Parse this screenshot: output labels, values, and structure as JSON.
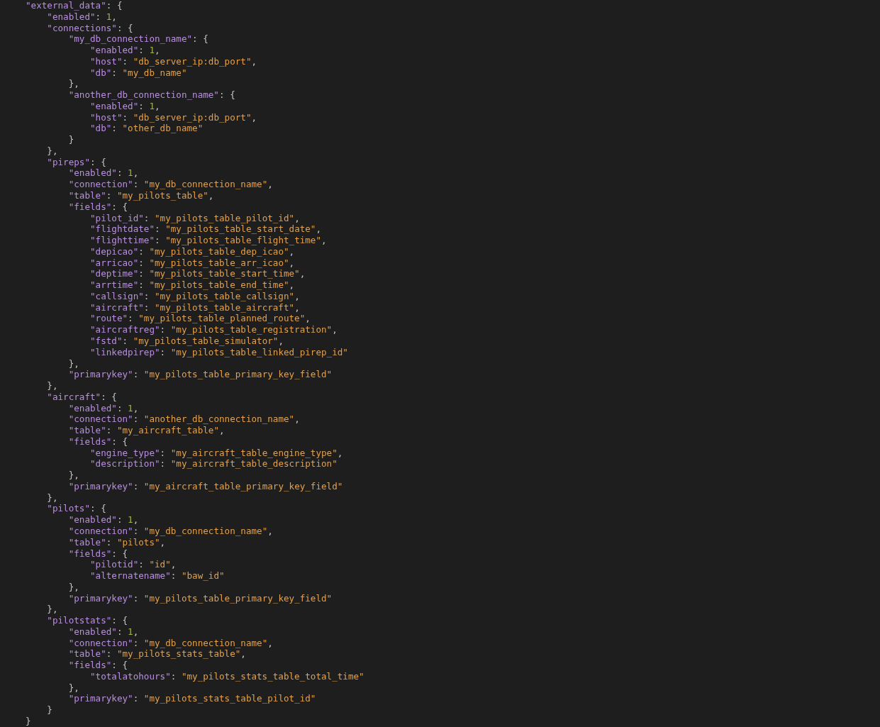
{
  "code": [
    {
      "key": "\"external_data\"",
      "colon": ":",
      "open": "{",
      "close": "}",
      "children": [
        {
          "key": "\"enabled\"",
          "colon": ":",
          "value": "1",
          "kind": "number",
          "end": ","
        },
        {
          "key": "\"connections\"",
          "colon": ":",
          "open": "{",
          "close": "},",
          "children": [
            {
              "key": "\"my_db_connection_name\"",
              "colon": ":",
              "open": "{",
              "close": "},",
              "children": [
                {
                  "key": "\"enabled\"",
                  "colon": ":",
                  "value": "1",
                  "kind": "number",
                  "end": ","
                },
                {
                  "key": "\"host\"",
                  "colon": ":",
                  "value": "\"db_server_ip:db_port\"",
                  "kind": "string",
                  "end": ","
                },
                {
                  "key": "\"db\"",
                  "colon": ":",
                  "value": "\"my_db_name\"",
                  "kind": "string"
                }
              ]
            },
            {
              "key": "\"another_db_connection_name\"",
              "colon": ":",
              "open": "{",
              "close": "}",
              "children": [
                {
                  "key": "\"enabled\"",
                  "colon": ":",
                  "value": "1",
                  "kind": "number",
                  "end": ","
                },
                {
                  "key": "\"host\"",
                  "colon": ":",
                  "value": "\"db_server_ip:db_port\"",
                  "kind": "string",
                  "end": ","
                },
                {
                  "key": "\"db\"",
                  "colon": ":",
                  "value": "\"other_db_name\"",
                  "kind": "string"
                }
              ]
            }
          ]
        },
        {
          "key": "\"pireps\"",
          "colon": ":",
          "open": "{",
          "close": "},",
          "children": [
            {
              "key": "\"enabled\"",
              "colon": ":",
              "value": "1",
              "kind": "number",
              "end": ","
            },
            {
              "key": "\"connection\"",
              "colon": ":",
              "value": "\"my_db_connection_name\"",
              "kind": "string",
              "end": ","
            },
            {
              "key": "\"table\"",
              "colon": ":",
              "value": "\"my_pilots_table\"",
              "kind": "string",
              "end": ","
            },
            {
              "key": "\"fields\"",
              "colon": ":",
              "open": "{",
              "close": "},",
              "children": [
                {
                  "key": "\"pilot_id\"",
                  "colon": ":",
                  "value": "\"my_pilots_table_pilot_id\"",
                  "kind": "string",
                  "end": ","
                },
                {
                  "key": "\"flightdate\"",
                  "colon": ":",
                  "value": "\"my_pilots_table_start_date\"",
                  "kind": "string",
                  "end": ","
                },
                {
                  "key": "\"flighttime\"",
                  "colon": ":",
                  "value": "\"my_pilots_table_flight_time\"",
                  "kind": "string",
                  "end": ","
                },
                {
                  "key": "\"depicao\"",
                  "colon": ":",
                  "value": "\"my_pilots_table_dep_icao\"",
                  "kind": "string",
                  "end": ","
                },
                {
                  "key": "\"arricao\"",
                  "colon": ":",
                  "value": "\"my_pilots_table_arr_icao\"",
                  "kind": "string",
                  "end": ","
                },
                {
                  "key": "\"deptime\"",
                  "colon": ":",
                  "value": "\"my_pilots_table_start_time\"",
                  "kind": "string",
                  "end": ","
                },
                {
                  "key": "\"arrtime\"",
                  "colon": ":",
                  "value": "\"my_pilots_table_end_time\"",
                  "kind": "string",
                  "end": ","
                },
                {
                  "key": "\"callsign\"",
                  "colon": ":",
                  "value": "\"my_pilots_table_callsign\"",
                  "kind": "string",
                  "end": ","
                },
                {
                  "key": "\"aircraft\"",
                  "colon": ":",
                  "value": "\"my_pilots_table_aircraft\"",
                  "kind": "string",
                  "end": ","
                },
                {
                  "key": "\"route\"",
                  "colon": ":",
                  "value": "\"my_pilots_table_planned_route\"",
                  "kind": "string",
                  "end": ","
                },
                {
                  "key": "\"aircraftreg\"",
                  "colon": ":",
                  "value": "\"my_pilots_table_registration\"",
                  "kind": "string",
                  "end": ","
                },
                {
                  "key": "\"fstd\"",
                  "colon": ":",
                  "value": "\"my_pilots_table_simulator\"",
                  "kind": "string",
                  "end": ","
                },
                {
                  "key": "\"linkedpirep\"",
                  "colon": ":",
                  "value": "\"my_pilots_table_linked_pirep_id\"",
                  "kind": "string"
                }
              ]
            },
            {
              "key": "\"primarykey\"",
              "colon": ":",
              "value": "\"my_pilots_table_primary_key_field\"",
              "kind": "string"
            }
          ]
        },
        {
          "key": "\"aircraft\"",
          "colon": ":",
          "open": "{",
          "close": "},",
          "children": [
            {
              "key": "\"enabled\"",
              "colon": ":",
              "value": "1",
              "kind": "number",
              "end": ","
            },
            {
              "key": "\"connection\"",
              "colon": ":",
              "value": "\"another_db_connection_name\"",
              "kind": "string",
              "end": ","
            },
            {
              "key": "\"table\"",
              "colon": ":",
              "value": "\"my_aircraft_table\"",
              "kind": "string",
              "end": ","
            },
            {
              "key": "\"fields\"",
              "colon": ":",
              "open": "{",
              "close": "},",
              "children": [
                {
                  "key": "\"engine_type\"",
                  "colon": ":",
                  "value": "\"my_aircraft_table_engine_type\"",
                  "kind": "string",
                  "end": ","
                },
                {
                  "key": "\"description\"",
                  "colon": ":",
                  "value": "\"my_aircraft_table_description\"",
                  "kind": "string"
                }
              ]
            },
            {
              "key": "\"primarykey\"",
              "colon": ":",
              "value": "\"my_aircraft_table_primary_key_field\"",
              "kind": "string"
            }
          ]
        },
        {
          "key": "\"pilots\"",
          "colon": ":",
          "open": "{",
          "close": "},",
          "children": [
            {
              "key": "\"enabled\"",
              "colon": ":",
              "value": "1",
              "kind": "number",
              "end": ","
            },
            {
              "key": "\"connection\"",
              "colon": ":",
              "value": "\"my_db_connection_name\"",
              "kind": "string",
              "end": ","
            },
            {
              "key": "\"table\"",
              "colon": ":",
              "value": "\"pilots\"",
              "kind": "string",
              "end": ","
            },
            {
              "key": "\"fields\"",
              "colon": ":",
              "open": "{",
              "close": "},",
              "children": [
                {
                  "key": "\"pilotid\"",
                  "colon": ":",
                  "value": "\"id\"",
                  "kind": "string",
                  "end": ","
                },
                {
                  "key": "\"alternatename\"",
                  "colon": ":",
                  "value": "\"baw_id\"",
                  "kind": "string"
                }
              ]
            },
            {
              "key": "\"primarykey\"",
              "colon": ":",
              "value": "\"my_pilots_table_primary_key_field\"",
              "kind": "string"
            }
          ]
        },
        {
          "key": "\"pilotstats\"",
          "colon": ":",
          "open": "{",
          "close": "}",
          "children": [
            {
              "key": "\"enabled\"",
              "colon": ":",
              "value": "1",
              "kind": "number",
              "end": ","
            },
            {
              "key": "\"connection\"",
              "colon": ":",
              "value": "\"my_db_connection_name\"",
              "kind": "string",
              "end": ","
            },
            {
              "key": "\"table\"",
              "colon": ":",
              "value": "\"my_pilots_stats_table\"",
              "kind": "string",
              "end": ","
            },
            {
              "key": "\"fields\"",
              "colon": ":",
              "open": "{",
              "close": "},",
              "children": [
                {
                  "key": "\"totalatohours\"",
                  "colon": ":",
                  "value": "\"my_pilots_stats_table_total_time\"",
                  "kind": "string"
                }
              ]
            },
            {
              "key": "\"primarykey\"",
              "colon": ":",
              "value": "\"my_pilots_stats_table_pilot_id\"",
              "kind": "string"
            }
          ]
        }
      ]
    }
  ]
}
